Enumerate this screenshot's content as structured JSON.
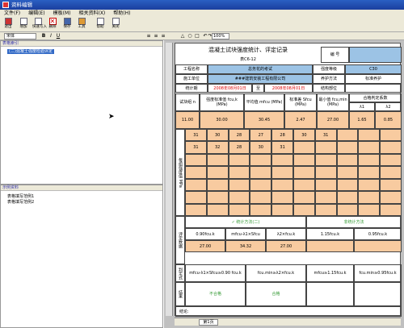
{
  "window": {
    "title": "资料编辑"
  },
  "menu": [
    "文件(F)",
    "编辑(E)",
    "模板(M)",
    "相关资料(X)",
    "帮助(H)"
  ],
  "toolbar": {
    "buttons": [
      "退出",
      "增加",
      "快速写入",
      "删除",
      "保存",
      "工具",
      "帮助",
      "关闭"
    ]
  },
  "format": {
    "font": "宋体",
    "zoom": "100%",
    "glyphs": [
      "B",
      "I",
      "U",
      "≡",
      "≡",
      "≡",
      "△",
      "○",
      "□",
      "↶",
      "↷"
    ]
  },
  "left": {
    "tree_header": "表格索引",
    "tree_item": "(二)混凝土强度检验评定",
    "bottom_header": "示例资料",
    "bottom_items": [
      "表格填写范例1",
      "表格填写范例2"
    ]
  },
  "form": {
    "title": "混凝土试块强度统计、评定记录",
    "code_label": "表C6-12",
    "no_label": "编  号",
    "project_label": "工程名称",
    "project": "总务花的考试",
    "grade_label": "强度等级",
    "grade": "C30",
    "unit_label": "施工单位",
    "unit": "###建筑安装工程有限公司",
    "cure_label": "养护方法",
    "cure": "标准养护",
    "period_label": "统计期",
    "period_from": "2008年08月01日",
    "period_to_label": "至",
    "period_to": "2008年08月01日",
    "part_label": "结构部位",
    "h_groups": "试块组 n",
    "h_std": "强度标准值 fcu,k (MPa)",
    "h_avg": "平均值 mfcu (MPa)",
    "h_sd": "标准差 Sfcu (MPa)",
    "h_min": "最小值 fcu,min (MPa)",
    "h_coef": "合格判定系数",
    "h_l1": "λ1",
    "h_l2": "λ2",
    "r_n": "11.00",
    "r_std": "30.00",
    "r_avg": "30.45",
    "r_sd": "2.47",
    "r_min": "27.00",
    "r_l1": "1.65",
    "r_l2": "0.85",
    "v1": [
      "31",
      "30",
      "28",
      "27",
      "28",
      "30",
      "31"
    ],
    "v2": [
      "31",
      "32",
      "28",
      "30",
      "31"
    ],
    "side_values": "每组强度值 MPa",
    "side_eval": "评定数据",
    "side_judge": "判定式",
    "side_result": "结果",
    "method1": "✓ 统计方法(二)",
    "method2": "非统计方法",
    "e1": "0.90fcu.k",
    "e2": "mfcu-λ1×Sfcu",
    "e3": "λ2×fcu.k",
    "e4": "1.15fcu.k",
    "e5": "0.95fcu.k",
    "e1v": "27.00",
    "e2v": "34.32",
    "e3v": "27.00",
    "j1": "mfcu-λ1×Sfcu≥0.90 fcu.k",
    "j2": "fcu.min≥λ2×fcu.k",
    "j3": "mfcu≥1.15fcu.k",
    "j4": "fcu.min≥0.95fcu.k",
    "res1": "不合格",
    "res2": "合格",
    "sign_label": "结论:",
    "sheet_tab": "第1页"
  }
}
